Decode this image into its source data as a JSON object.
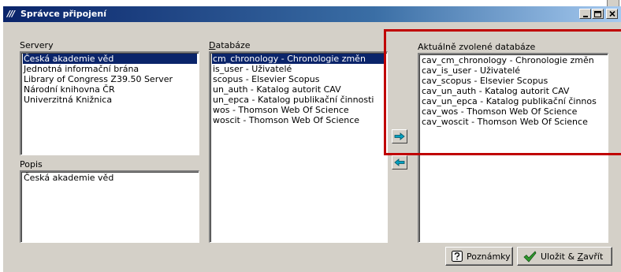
{
  "window": {
    "logo": "///",
    "title": "Správce připojení",
    "minimize_glyph": "_",
    "maximize_glyph": "□",
    "close_glyph": "×"
  },
  "servers": {
    "label": "Servery",
    "items": [
      {
        "label": "Česká akademie věd",
        "selected": true
      },
      {
        "label": "Jednotná informační brána",
        "selected": false
      },
      {
        "label": "Library of Congress Z39.50 Server",
        "selected": false
      },
      {
        "label": "Národní knihovna ČR",
        "selected": false
      },
      {
        "label": "Univerzitná Knižnica",
        "selected": false
      }
    ]
  },
  "description": {
    "label": "Popis",
    "text": "Česká akademie věd"
  },
  "databases": {
    "label_prefix": "D",
    "label_rest": "atabáze",
    "items": [
      {
        "label": "cm_chronology - Chronologie změn",
        "selected": true
      },
      {
        "label": "is_user - Uživatelé",
        "selected": false
      },
      {
        "label": "scopus - Elsevier Scopus",
        "selected": false
      },
      {
        "label": "un_auth - Katalog autorit CAV",
        "selected": false
      },
      {
        "label": "un_epca - Katalog publikační činnosti",
        "selected": false
      },
      {
        "label": "wos - Thomson Web Of Science",
        "selected": false
      },
      {
        "label": "woscit - Thomson Web Of Science",
        "selected": false
      }
    ]
  },
  "selected_databases": {
    "label": "Aktuálně zvolené databáze",
    "items": [
      "cav_cm_chronology - Chronologie změn",
      "cav_is_user - Uživatelé",
      "cav_scopus - Elsevier Scopus",
      "cav_un_auth - Katalog autorit CAV",
      "cav_un_epca - Katalog publikační činnos",
      "cav_wos - Thomson Web Of Science",
      "cav_woscit - Thomson Web Of Science"
    ]
  },
  "buttons": {
    "add_icon": "arrow-right-icon",
    "remove_icon": "arrow-left-icon",
    "notes_label": "Poznámky",
    "save_prefix": "Uložit & ",
    "save_underline": "Z",
    "save_rest": "avřít"
  },
  "colors": {
    "titlebar": "#0a246a",
    "selection": "#0a246a",
    "arrow": "#00a0c0",
    "highlight": "#c00000",
    "checkmark": "#2e9a2e"
  }
}
